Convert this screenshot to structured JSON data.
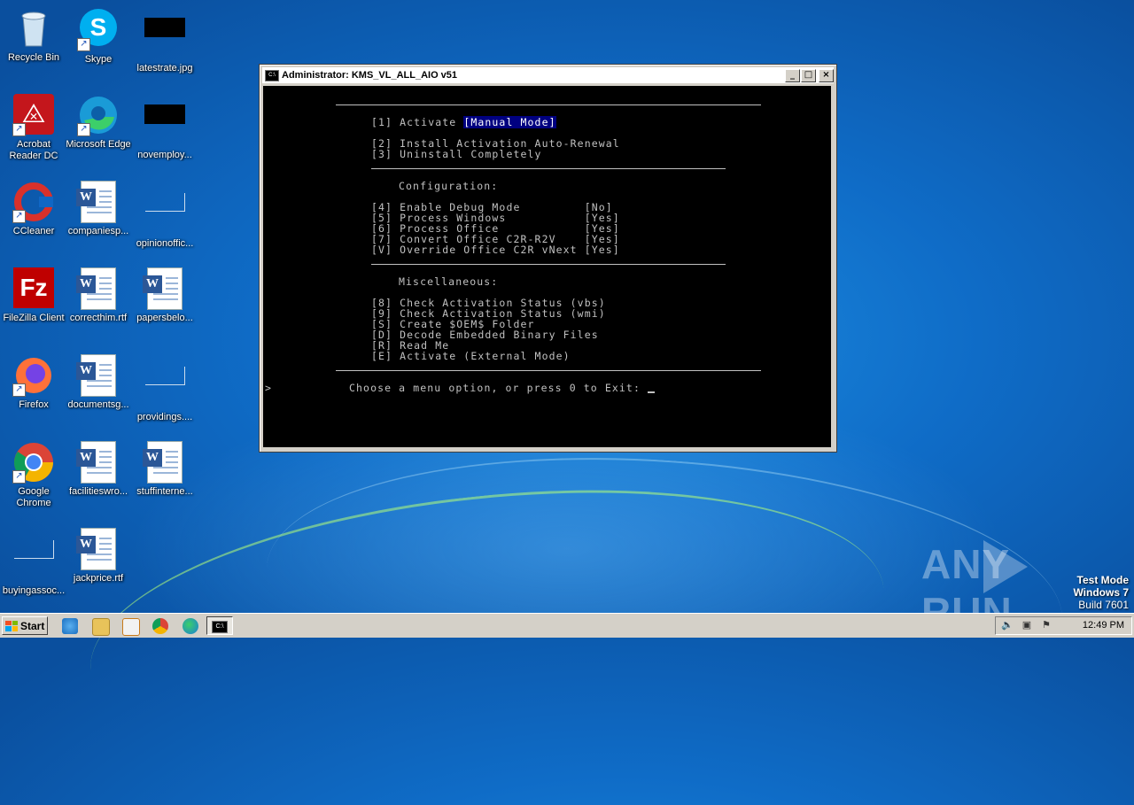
{
  "desktop": {
    "icons": [
      {
        "label": "Recycle Bin"
      },
      {
        "label": "Skype"
      },
      {
        "label": "latestrate.jpg"
      },
      {
        "label": "Acrobat Reader DC"
      },
      {
        "label": "Microsoft Edge"
      },
      {
        "label": "novemploy..."
      },
      {
        "label": "CCleaner"
      },
      {
        "label": "companiesp..."
      },
      {
        "label": "opinionoffic..."
      },
      {
        "label": "FileZilla Client"
      },
      {
        "label": "correcthim.rtf"
      },
      {
        "label": "papersbelo..."
      },
      {
        "label": "Firefox"
      },
      {
        "label": "documentsg..."
      },
      {
        "label": "providings...."
      },
      {
        "label": "Google Chrome"
      },
      {
        "label": "facilitieswro..."
      },
      {
        "label": "stuffinterne..."
      },
      {
        "label": "buyingassoc..."
      },
      {
        "label": "jackprice.rtf"
      }
    ]
  },
  "window": {
    "title": "Administrator: KMS_VL_ALL_AIO v51",
    "minimize": "_",
    "maximize": "□",
    "close": "×"
  },
  "console": {
    "opt1_prefix": "[1] Activate ",
    "opt1_highlight": "[Manual Mode]",
    "opt2": "[2] Install Activation Auto-Renewal",
    "opt3": "[3] Uninstall Completely",
    "config_header": "Configuration:",
    "opt4": "[4] Enable Debug Mode         [No]",
    "opt5": "[5] Process Windows           [Yes]",
    "opt6": "[6] Process Office            [Yes]",
    "opt7": "[7] Convert Office C2R-R2V    [Yes]",
    "optV": "[V] Override Office C2R vNext [Yes]",
    "misc_header": "Miscellaneous:",
    "opt8": "[8] Check Activation Status (vbs)",
    "opt9": "[9] Check Activation Status (wmi)",
    "optS": "[S] Create $OEM$ Folder",
    "optD": "[D] Decode Embedded Binary Files",
    "optR": "[R] Read Me",
    "optE": "[E] Activate (External Mode)",
    "prompt_marker": ">",
    "prompt": "Choose a menu option, or press 0 to Exit: "
  },
  "watermark": {
    "any": "ANY",
    "run": "RUN",
    "mode": "Test Mode",
    "os": "Windows 7",
    "build": "Build 7601"
  },
  "taskbar": {
    "start_label": "Start",
    "clock": "12:49 PM"
  }
}
